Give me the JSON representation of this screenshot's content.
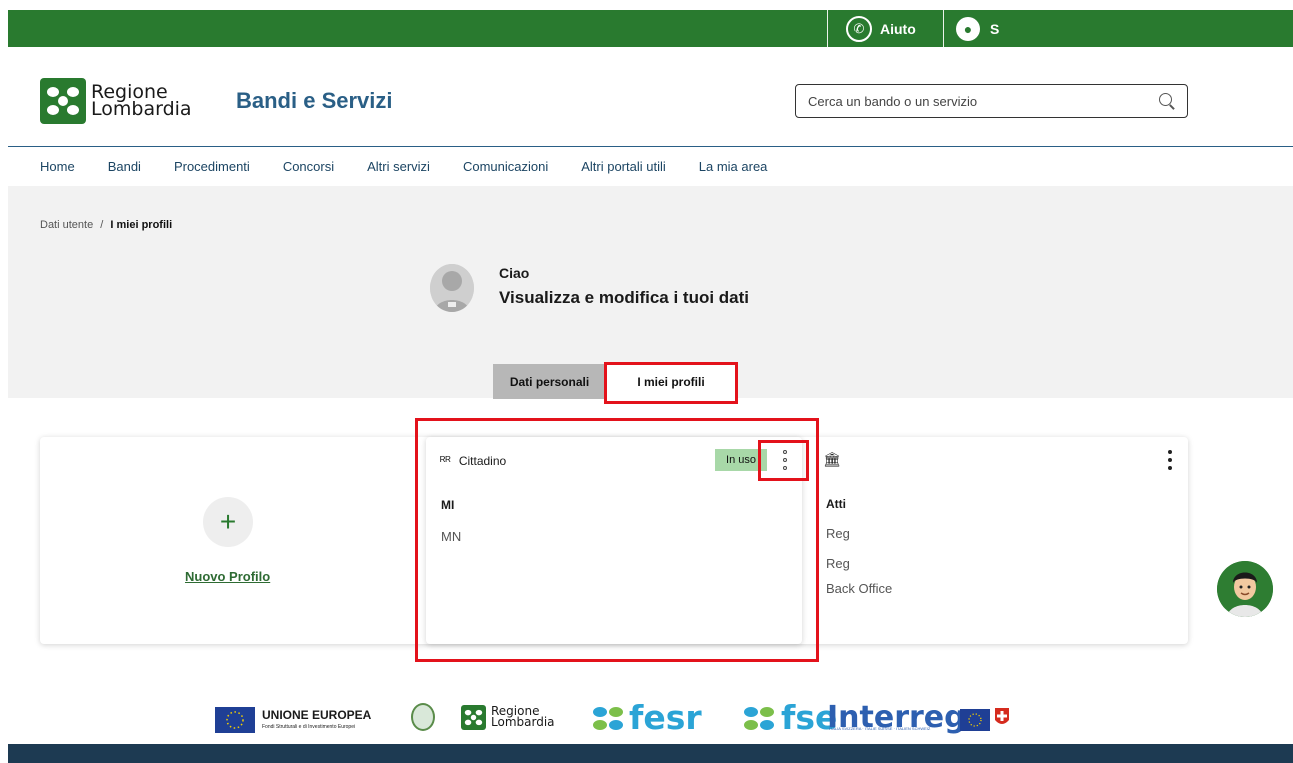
{
  "topbar": {
    "help_label": "Aiuto",
    "user_label": "S"
  },
  "header": {
    "logo_line1": "Regione",
    "logo_line2": "Lombardia",
    "title": "Bandi e Servizi",
    "search_placeholder": "Cerca un bando o un servizio"
  },
  "nav": {
    "items": [
      "Home",
      "Bandi",
      "Procedimenti",
      "Concorsi",
      "Altri servizi",
      "Comunicazioni",
      "Altri portali utili",
      "La mia area"
    ]
  },
  "breadcrumb": {
    "parent": "Dati utente",
    "separator": "/",
    "current": "I miei profili"
  },
  "profile_header": {
    "greeting": "Ciao",
    "subtitle": "Visualizza e modifica i tuoi dati"
  },
  "tabs": {
    "personal": "Dati personali",
    "profiles": "I miei profili"
  },
  "cards": {
    "new_profile_label": "Nuovo Profilo",
    "citizen": {
      "title": "Cittadino",
      "badge": "In uso",
      "line1": "MI",
      "line2": "MN"
    },
    "other": {
      "title": "Atti",
      "rows": [
        "Reg",
        "Reg",
        "Back Office"
      ]
    }
  },
  "footer": {
    "eu_title": "UNIONE EUROPEA",
    "eu_subtitle": "Fondi Strutturali e di Investimento Europei",
    "rl_line1": "Regione",
    "rl_line2": "Lombardia",
    "fesr": "fesr",
    "fse": "fse",
    "interreg": "Interreg",
    "interreg_subtitle": "ITALIA SVIZZERA · ITALIE SUISSE · ITALIEN SCHWEIZ"
  },
  "colors": {
    "primary_green": "#297a2f",
    "brand_blue": "#2a5f86",
    "highlight_red": "#e3121b",
    "badge_green": "#a8d8a8"
  }
}
